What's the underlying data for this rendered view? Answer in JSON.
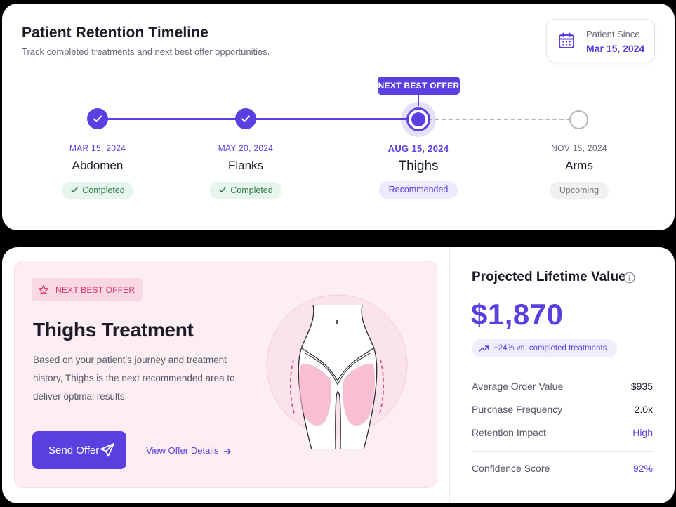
{
  "timeline": {
    "title": "Patient Retention Timeline",
    "subtitle": "Track completed treatments and next best offer opportunities.",
    "patient_since": {
      "label": "Patient Since",
      "date": "Mar 15, 2024",
      "icon": "calendar-icon"
    },
    "next_best_offer_marker": "NEXT BEST OFFER",
    "steps": [
      {
        "date": "MAR 15, 2024",
        "area": "Abdomen",
        "status": "Completed"
      },
      {
        "date": "MAY 20, 2024",
        "area": "Flanks",
        "status": "Completed"
      },
      {
        "date": "AUG 15, 2024",
        "area": "Thighs",
        "status": "Recommended"
      },
      {
        "date": "NOV 15, 2024",
        "area": "Arms",
        "status": "Upcoming"
      }
    ]
  },
  "offer": {
    "tag": "NEXT BEST OFFER",
    "title": "Thighs Treatment",
    "description": "Based on your patient’s journey and treatment history, Thighs is the next recommended area to deliver optimal results.",
    "send_button": "Send Offer",
    "view_link": "View Offer Details"
  },
  "ltv": {
    "title": "Projected Lifetime Value",
    "value": "$1,870",
    "change": "+24% vs. completed treatments",
    "metrics": [
      {
        "label": "Average Order Value",
        "value": "$935"
      },
      {
        "label": "Purchase Frequency",
        "value": "2.0x"
      },
      {
        "label": "Retention Impact",
        "value": "High"
      }
    ],
    "confidence": {
      "label": "Confidence Score",
      "value": "92%"
    }
  },
  "colors": {
    "accent": "#5b3fe0",
    "success": "#2d7a4a",
    "offer_pink": "#d6336c",
    "panel_pink": "#fdeef4"
  }
}
